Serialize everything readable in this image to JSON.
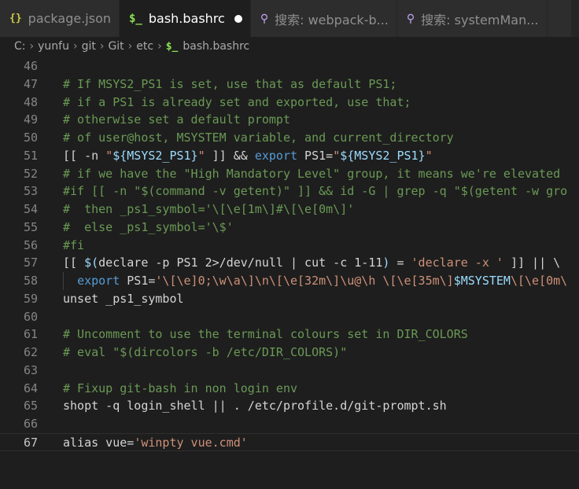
{
  "tabs": [
    {
      "label": "package.json",
      "icon": "json-braces-icon",
      "glyph": "{}",
      "active": false
    },
    {
      "label": "bash.bashrc",
      "icon": "shell-file-icon",
      "glyph": "$_",
      "active": true,
      "dirty": true
    },
    {
      "label": "搜索: webpack-b...",
      "icon": "search-icon",
      "glyph": "⚲",
      "active": false
    },
    {
      "label": "搜索: systemMan...",
      "icon": "search-icon",
      "glyph": "⚲",
      "active": false
    }
  ],
  "breadcrumb": {
    "segments": [
      "C:",
      "yunfu",
      "git",
      "Git",
      "etc"
    ],
    "file": "bash.bashrc",
    "file_glyph": "$_",
    "separator": "›"
  },
  "editor": {
    "current_line": 67,
    "lines": [
      {
        "n": "46",
        "t": []
      },
      {
        "n": "47",
        "t": [
          [
            "c",
            "# If MSYS2_PS1 is set, use that as default PS1;"
          ]
        ]
      },
      {
        "n": "48",
        "t": [
          [
            "c",
            "# if a PS1 is already set and exported, use that;"
          ]
        ]
      },
      {
        "n": "49",
        "t": [
          [
            "c",
            "# otherwise set a default prompt"
          ]
        ]
      },
      {
        "n": "50",
        "t": [
          [
            "c",
            "# of user@host, MSYSTEM variable, and current_directory"
          ]
        ]
      },
      {
        "n": "51",
        "t": [
          [
            "p",
            "[[ -n "
          ],
          [
            "s",
            "\""
          ],
          [
            "v",
            "${MSYS2_PS1}"
          ],
          [
            "s",
            "\""
          ],
          [
            "p",
            " ]] && "
          ],
          [
            "k",
            "export"
          ],
          [
            "p",
            " PS1="
          ],
          [
            "s",
            "\""
          ],
          [
            "v",
            "${MSYS2_PS1}"
          ],
          [
            "s",
            "\""
          ]
        ]
      },
      {
        "n": "52",
        "t": [
          [
            "c",
            "# if we have the \"High Mandatory Level\" group, it means we're elevated"
          ]
        ]
      },
      {
        "n": "53",
        "t": [
          [
            "c",
            "#if [[ -n \"$(command -v getent)\" ]] && id -G | grep -q \"$(getent -w gro"
          ]
        ]
      },
      {
        "n": "54",
        "t": [
          [
            "c",
            "#  then _ps1_symbol='\\[\\e[1m\\]#\\[\\e[0m\\]'"
          ]
        ]
      },
      {
        "n": "55",
        "t": [
          [
            "c",
            "#  else _ps1_symbol='\\$'"
          ]
        ]
      },
      {
        "n": "56",
        "t": [
          [
            "c",
            "#fi"
          ]
        ]
      },
      {
        "n": "57",
        "t": [
          [
            "p",
            "[[ "
          ],
          [
            "v",
            "$("
          ],
          [
            "p",
            "declare -p PS1 2>/dev/null | cut -c 1-11"
          ],
          [
            "v",
            ")"
          ],
          [
            "p",
            " = "
          ],
          [
            "s",
            "'declare -x '"
          ],
          [
            "p",
            " ]] || \\"
          ]
        ]
      },
      {
        "n": "58",
        "guide": true,
        "t": [
          [
            "p",
            "  "
          ],
          [
            "k",
            "export"
          ],
          [
            "p",
            " PS1="
          ],
          [
            "s",
            "'\\[\\e]0;\\w\\a\\]\\n\\[\\e[32m\\]\\u@\\h \\[\\e[35m\\]"
          ],
          [
            "v",
            "$MSYSTEM"
          ],
          [
            "s",
            "\\[\\e[0m\\"
          ]
        ]
      },
      {
        "n": "59",
        "t": [
          [
            "p",
            "unset _ps1_symbol"
          ]
        ]
      },
      {
        "n": "60",
        "t": []
      },
      {
        "n": "61",
        "t": [
          [
            "c",
            "# Uncomment to use the terminal colours set in DIR_COLORS"
          ]
        ]
      },
      {
        "n": "62",
        "t": [
          [
            "c",
            "# eval \"$(dircolors -b /etc/DIR_COLORS)\""
          ]
        ]
      },
      {
        "n": "63",
        "t": []
      },
      {
        "n": "64",
        "t": [
          [
            "c",
            "# Fixup git-bash in non login env"
          ]
        ]
      },
      {
        "n": "65",
        "t": [
          [
            "p",
            "shopt -q login_shell || . /etc/profile.d/git-prompt.sh"
          ]
        ]
      },
      {
        "n": "66",
        "t": []
      },
      {
        "n": "67",
        "t": [
          [
            "p",
            "alias vue="
          ],
          [
            "s",
            "'winpty vue.cmd'"
          ]
        ]
      }
    ]
  }
}
